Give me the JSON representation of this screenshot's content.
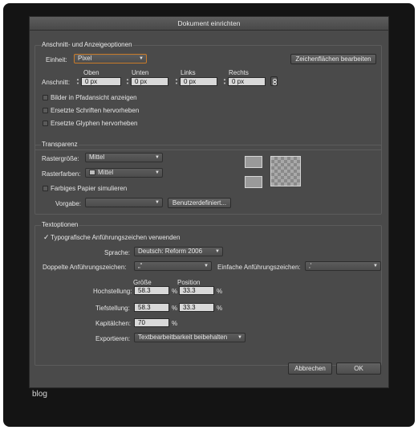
{
  "dialog": {
    "title": "Dokument einrichten"
  },
  "bleed": {
    "legend": "Anschnitt- und Anzeigeoptionen",
    "unit_label": "Einheit:",
    "unit_value": "Pixel",
    "artboards_button": "Zeichenflächen bearbeiten",
    "bleed_label": "Anschnitt:",
    "top_label": "Oben",
    "top_value": "0 px",
    "bottom_label": "Unten",
    "bottom_value": "0 px",
    "left_label": "Links",
    "left_value": "0 px",
    "right_label": "Rechts",
    "right_value": "0 px",
    "opt_outline_images": "Bilder in Pfadansicht anzeigen",
    "opt_substituted_fonts": "Ersetzte Schriften hervorheben",
    "opt_substituted_glyphs": "Ersetzte Glyphen hervorheben"
  },
  "transparency": {
    "legend": "Transparenz",
    "grid_size_label": "Rastergröße:",
    "grid_size_value": "Mittel",
    "grid_colors_label": "Rasterfarben:",
    "grid_colors_value": "Mittel",
    "simulate_paper": "Farbiges Papier simulieren",
    "preset_label": "Vorgabe:",
    "preset_value": "",
    "custom_button": "Benutzerdefiniert..."
  },
  "type": {
    "legend": "Textoptionen",
    "typographers_quotes": "Typografische Anführungszeichen verwenden",
    "typographers_quotes_checked": true,
    "language_label": "Sprache:",
    "language_value": "Deutsch: Reform 2006",
    "double_quotes_label": "Doppelte Anführungszeichen:",
    "double_quotes_value": "„“",
    "single_quotes_label": "Einfache Anführungszeichen:",
    "single_quotes_value": "‚‘",
    "size_header": "Größe",
    "position_header": "Position",
    "superscript_label": "Hochstellung:",
    "superscript_size": "58.3",
    "superscript_position": "33.3",
    "subscript_label": "Tiefstellung:",
    "subscript_size": "58.3",
    "subscript_position": "33.3",
    "small_caps_label": "Kapitälchen:",
    "small_caps_value": "70",
    "percent": "%",
    "export_label": "Exportieren:",
    "export_value": "Textbearbeitbarkeit beibehalten"
  },
  "footer": {
    "cancel": "Abbrechen",
    "ok": "OK"
  },
  "watermark": "blog"
}
